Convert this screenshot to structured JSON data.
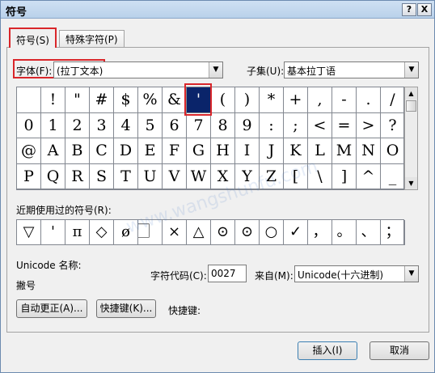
{
  "window": {
    "title": "符号",
    "help": "?",
    "close": "X"
  },
  "tabs": [
    {
      "label": "符号(S)"
    },
    {
      "label": "特殊字符(P)"
    }
  ],
  "font": {
    "label": "字体(F):",
    "value": "(拉丁文本)"
  },
  "subset": {
    "label": "子集(U):",
    "value": "基本拉丁语"
  },
  "grid_rows": [
    [
      "",
      " !",
      "\"",
      "#",
      "$",
      "%",
      "&",
      "'",
      "(",
      ")",
      "*",
      "+",
      ",",
      "-",
      ".",
      "/"
    ],
    [
      "0",
      "1",
      "2",
      "3",
      "4",
      "5",
      "6",
      "7",
      "8",
      "9",
      ":",
      ";",
      "<",
      "=",
      ">",
      "?"
    ],
    [
      "@",
      "A",
      "B",
      "C",
      "D",
      "E",
      "F",
      "G",
      "H",
      "I",
      "J",
      "K",
      "L",
      "M",
      "N",
      "O"
    ],
    [
      "P",
      "Q",
      "R",
      "S",
      "T",
      "U",
      "V",
      "W",
      "X",
      "Y",
      "Z",
      "[",
      "\\",
      "]",
      "^",
      "_"
    ]
  ],
  "selected": {
    "row": 0,
    "col": 7
  },
  "recent_label": "近期使用过的符号(R):",
  "recent": [
    "▽",
    "'",
    "π",
    "◇",
    "ø",
    "⃞",
    "×",
    "△",
    "⊙",
    "⊙",
    "○",
    "✓",
    "，",
    "。",
    "、",
    "；"
  ],
  "unicode_name_label": "Unicode 名称:",
  "unicode_name": "撇号",
  "char_code_label": "字符代码(C):",
  "char_code": "0027",
  "from_label": "来自(M):",
  "from_value": "Unicode(十六进制)",
  "buttons": {
    "autocorrect": "自动更正(A)...",
    "shortcut_key": "快捷键(K)...",
    "insert": "插入(I)",
    "cancel": "取消"
  },
  "shortcut_label": "快捷键:",
  "watermark": "www.wangshunfu.com",
  "colors": {
    "selection": "#0a246a",
    "highlight": "#d9262a"
  }
}
